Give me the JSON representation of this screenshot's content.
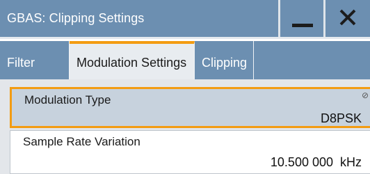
{
  "window": {
    "title": "GBAS: Clipping Settings",
    "minimize_icon": "minimize-icon",
    "close_icon": "close-icon"
  },
  "tabs": [
    {
      "label": "Filter",
      "active": false
    },
    {
      "label": "Modulation Settings",
      "active": true
    },
    {
      "label": "Clipping",
      "active": false
    }
  ],
  "fields": {
    "modulation_type": {
      "label": "Modulation Type",
      "value": "D8PSK",
      "icon": "no-symbol-icon"
    },
    "sample_rate_variation": {
      "label": "Sample Rate Variation",
      "value": "10.500 000",
      "unit": "kHz"
    }
  },
  "colors": {
    "titlebar": "#6c8fb1",
    "accent": "#f39c12",
    "focused_field": "#c7d2dd"
  }
}
